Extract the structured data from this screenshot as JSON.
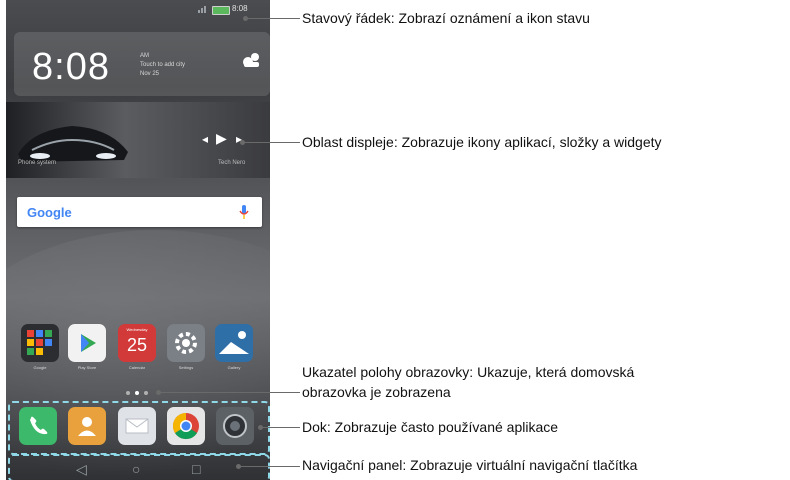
{
  "status_bar": {
    "time": "8:08"
  },
  "clock_widget": {
    "time": "8:08",
    "info_line1": "AM",
    "info_line2": "Touch to add city",
    "info_line3": "Nov 25"
  },
  "music_widget": {
    "song": "Phone system",
    "artist": "Tech Nero"
  },
  "search": {
    "brand": "Google"
  },
  "apps": [
    {
      "label": "Google"
    },
    {
      "label": "Play Store"
    },
    {
      "label": "Calendar",
      "day": "Wednesday",
      "date": "25"
    },
    {
      "label": "Settings"
    },
    {
      "label": "Gallery"
    }
  ],
  "callouts": {
    "status": "Stavový řádek: Zobrazí oznámení a ikon stavu",
    "display": "Oblast displeje: Zobrazuje ikony aplikací, složky a widgety",
    "indicator_line1": "Ukazatel polohy obrazovky: Ukazuje, která domovská",
    "indicator_line2": "obrazovka je zobrazena",
    "dock": "Dok: Zobrazuje často používané aplikace",
    "nav": "Navigační panel: Zobrazuje virtuální navigační tlačítka"
  },
  "colors": {
    "dash": "#8fd8e8",
    "leader": "#6a6a6a",
    "phone": "#3a3c3f"
  }
}
